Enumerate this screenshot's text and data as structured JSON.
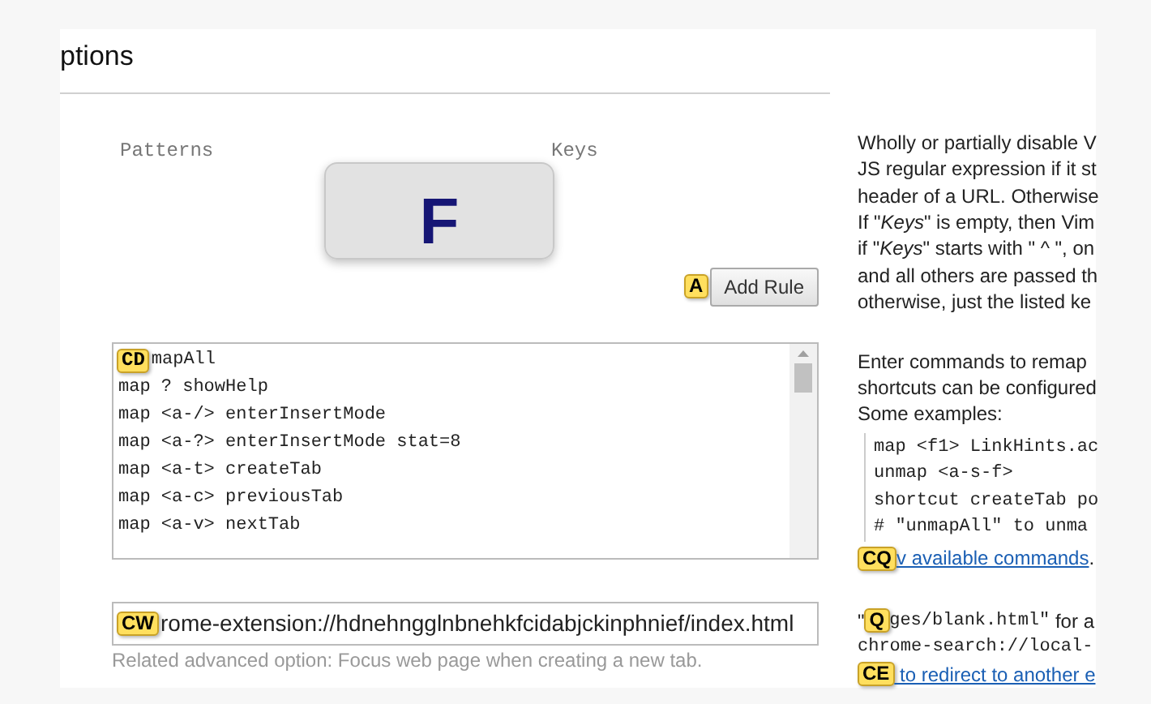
{
  "title": "ptions",
  "exclusions": {
    "columns": [
      "Patterns",
      "Keys"
    ],
    "add_button": {
      "label": "Add Rule",
      "hint": "A"
    }
  },
  "key_mappings": {
    "hint": "CD",
    "lines": [
      "mapAll",
      "map ? showHelp",
      "map <a-/> enterInsertMode",
      "map <a-?> enterInsertMode stat=8",
      "map <a-t> createTab",
      "map <a-c> previousTab",
      "map <a-v> nextTab"
    ]
  },
  "new_tab_url": {
    "hint": "CW",
    "value": "rome-extension://hdnehngglnbnehkfcidabjckinphnief/index.html",
    "help": [
      "Related advanced option: Focus web page when creating a new tab."
    ]
  },
  "sidebar": {
    "exclusions_help": [
      "Wholly or partially disable V",
      "JS regular expression if it st",
      "header of a URL. Otherwise",
      "If \"*Keys*\" is empty, then Vim",
      "if \"*Keys*\" starts with \" ^ \", on",
      "and all others are passed th",
      "otherwise, just the listed ke"
    ],
    "mappings_help": [
      "Enter commands to remap",
      "shortcuts can be configured",
      "Some examples:"
    ],
    "examples": [
      "map <f1> LinkHints.ac",
      "unmap <a-s-f>",
      "shortcut createTab po",
      "# \"unmapAll\" to unma"
    ],
    "commands_link": {
      "hint": "CQ",
      "label": "v available commands",
      "suffix": "."
    },
    "new_tab_help": [
      {
        "kind": "code",
        "prefix": "\"",
        "hint": "Q",
        "code": "ges/blank.html\"",
        "text": " for a"
      },
      {
        "kind": "plain",
        "code": "chrome-search://local-"
      },
      {
        "kind": "link",
        "hint": "CE",
        "text": " to redirect to another e"
      }
    ]
  },
  "key_overlay": "F"
}
